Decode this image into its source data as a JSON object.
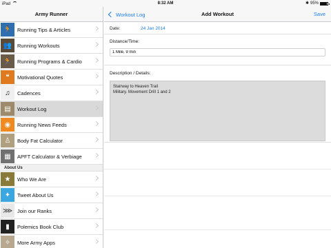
{
  "status_bar": {
    "device": "iPad",
    "time": "8:32 AM",
    "battery": "95%"
  },
  "sidebar": {
    "title": "Army Runner",
    "items": [
      {
        "label": "Running Tips & Articles",
        "icon": "runner-icon",
        "color": "#2f6fb0"
      },
      {
        "label": "Running Workouts",
        "icon": "running-crowd-icon",
        "color": "#5a4a38"
      },
      {
        "label": "Running Programs & Cardio",
        "icon": "runners-icon",
        "color": "#6a5a48"
      },
      {
        "label": "Motivational Quotes",
        "icon": "quote-icon",
        "color": "#e07a1e"
      },
      {
        "label": "Cadences",
        "icon": "music-note-icon",
        "color": "#3a3a3a"
      },
      {
        "label": "Workout Log",
        "icon": "logbook-icon",
        "color": "#9c8a6a"
      },
      {
        "label": "Running News Feeds",
        "icon": "rss-icon",
        "color": "#f08a20"
      },
      {
        "label": "Body Fat Calculator",
        "icon": "body-icon",
        "color": "#b0a080"
      },
      {
        "label": "APFT Calculator & Verbiage",
        "icon": "calculator-icon",
        "color": "#707070"
      }
    ],
    "section_about": "About Us",
    "about_items": [
      {
        "label": "Who We Are",
        "icon": "soldier-icon",
        "color": "#8a7a3a"
      },
      {
        "label": "Tweet About Us",
        "icon": "twitter-icon",
        "color": "#3aa7e0"
      },
      {
        "label": "Join our Ranks",
        "icon": "rank-icon",
        "color": "#c8c8c8"
      },
      {
        "label": "Polemics Book Club",
        "icon": "book-icon",
        "color": "#222222"
      },
      {
        "label": "More Army Apps",
        "icon": "compass-icon",
        "color": "#b8a890"
      }
    ]
  },
  "navbar": {
    "back_label": "Workout Log",
    "title": "Add Workout",
    "save_label": "Save"
  },
  "form": {
    "date_label": "Date:",
    "date_value": "24 Jan 2014",
    "distance_label": "Distance/Time:",
    "distance_value": "1 Mile, 9 min",
    "description_label": "Description / Details:",
    "description_value": "Stairway to Heaven Trail\nMilitary. Movement Drill 1 and 2"
  },
  "colors": {
    "accent": "#1a7cf5",
    "selected_row": "#d9d9d9"
  }
}
